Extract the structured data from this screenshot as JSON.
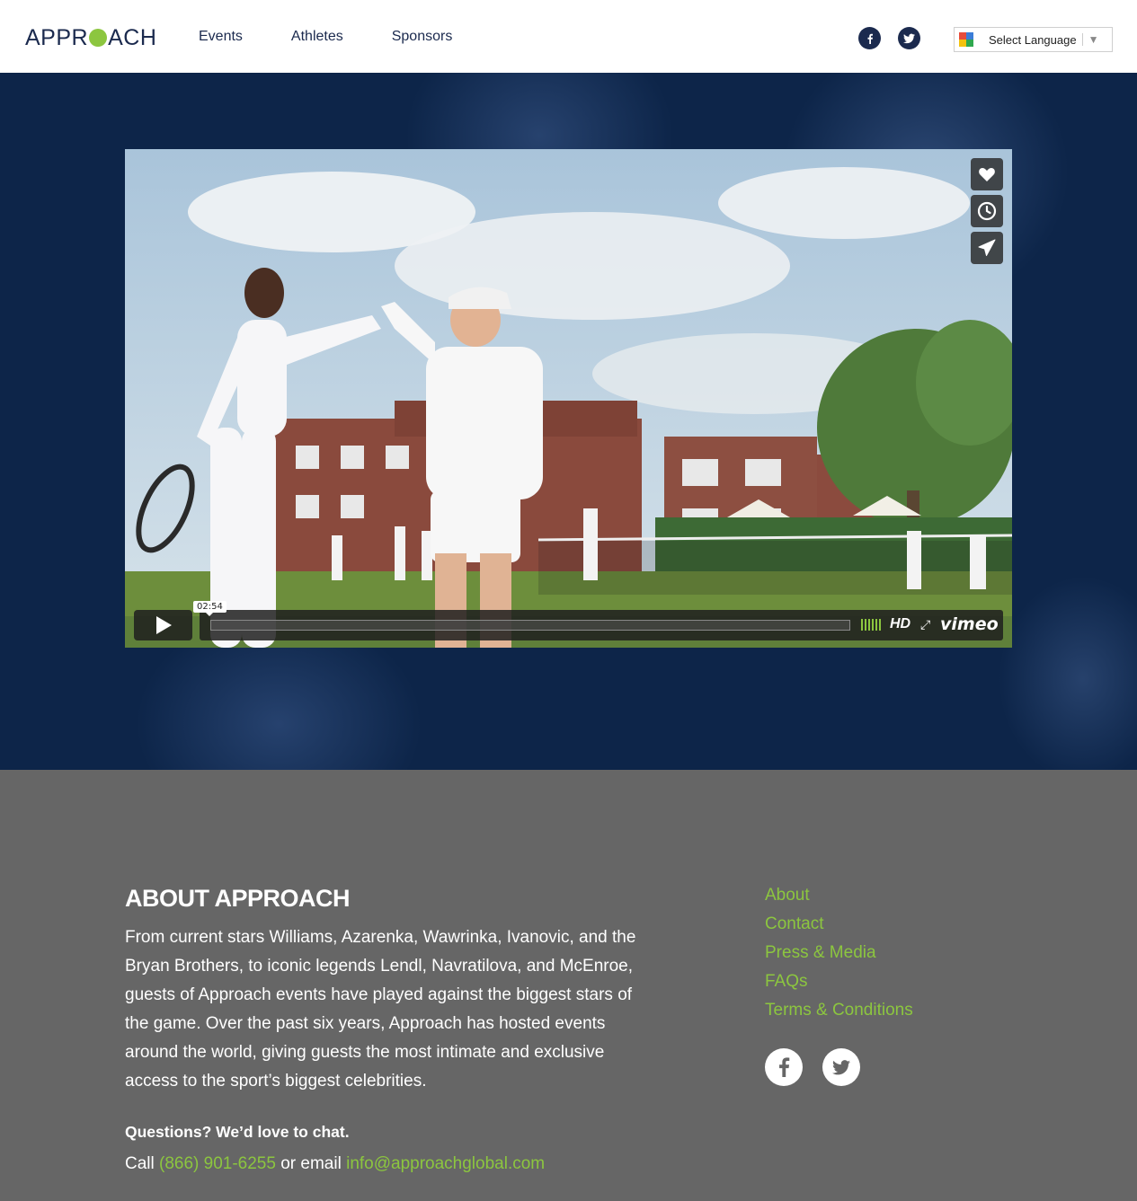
{
  "brand": {
    "logo_left": "APPR",
    "logo_right": "ACH",
    "accent_green": "#8cc63f",
    "navy": "#1b2a4e"
  },
  "nav": {
    "items": [
      {
        "label": "Events"
      },
      {
        "label": "Athletes"
      },
      {
        "label": "Sponsors"
      }
    ]
  },
  "header_social": {
    "facebook_icon": "facebook-icon",
    "twitter_icon": "twitter-icon"
  },
  "language": {
    "label": "Select Language",
    "caret": "▼"
  },
  "video": {
    "time_tooltip": "02:54",
    "hd_label": "HD",
    "brand_label": "vimeo",
    "side_buttons": [
      "heart-icon",
      "clock-icon",
      "send-icon"
    ]
  },
  "about": {
    "title": "ABOUT APPROACH",
    "body": "From current stars Williams, Azarenka, Wawrinka, Ivanovic, and the Bryan Brothers, to iconic legends Lendl, Navratilova, and McEnroe, guests of Approach events have played against the biggest stars of the game. Over the past six years, Approach has hosted events around the world, giving guests the most intimate and exclusive access to the sport’s biggest celebrities.",
    "questions": "Questions? We’d love to chat.",
    "call_prefix": "Call",
    "phone": "(866) 901-6255",
    "email_prefix": "or email",
    "email": "info@approachglobal.com"
  },
  "footer_links": [
    {
      "label": "About"
    },
    {
      "label": "Contact"
    },
    {
      "label": "Press & Media"
    },
    {
      "label": "FAQs"
    },
    {
      "label": "Terms & Conditions"
    }
  ]
}
